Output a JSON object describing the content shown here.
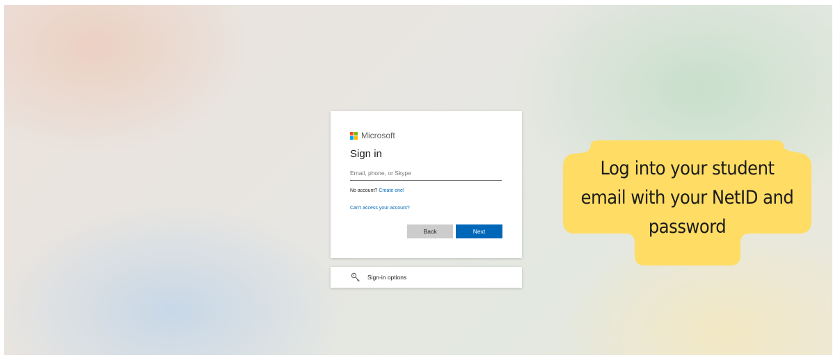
{
  "brand": {
    "name": "Microsoft",
    "logo_colors": [
      "#f25022",
      "#7fba00",
      "#00a4ef",
      "#ffb900"
    ]
  },
  "signin": {
    "title": "Sign in",
    "email_placeholder": "Email, phone, or Skype",
    "email_value": "",
    "no_account_text": "No account?",
    "create_link": "Create one!",
    "cant_access_link": "Can't access your account?",
    "back_label": "Back",
    "next_label": "Next",
    "accent_color": "#0067b8"
  },
  "signin_options": {
    "label": "Sign-in options",
    "icon": "key-icon"
  },
  "callout": {
    "lines": [
      "Log into your student",
      "email with your NetID and",
      "password"
    ],
    "color": "#ffdc63"
  }
}
